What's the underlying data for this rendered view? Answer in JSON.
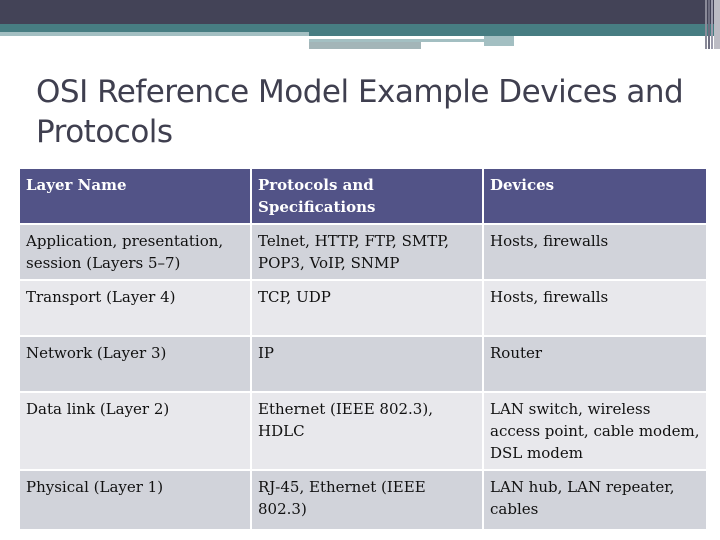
{
  "slide": {
    "title": "OSI Reference Model Example Devices and Protocols",
    "colors": {
      "top_bar": "#434357",
      "teal_bar": "#477d82",
      "header_fill": "#525387",
      "row_dark": "#d1d3da",
      "row_light": "#e8e8ec",
      "title_text": "#3f3f4f"
    }
  },
  "table": {
    "headers": [
      "Layer Name",
      "Protocols and Specifications",
      "Devices"
    ],
    "rows": [
      [
        "Application, presentation, session (Layers 5–7)",
        "Telnet, HTTP, FTP, SMTP, POP3, VoIP, SNMP",
        "Hosts, firewalls"
      ],
      [
        "Transport (Layer 4)",
        "TCP, UDP",
        "Hosts, firewalls"
      ],
      [
        "Network (Layer 3)",
        "IP",
        "Router"
      ],
      [
        "Data link (Layer 2)",
        "Ethernet (IEEE 802.3), HDLC",
        "LAN switch, wireless access point, cable modem, DSL modem"
      ],
      [
        "Physical (Layer 1)",
        "RJ-45,  Ethernet (IEEE 802.3)",
        "LAN hub, LAN repeater, cables"
      ]
    ]
  }
}
